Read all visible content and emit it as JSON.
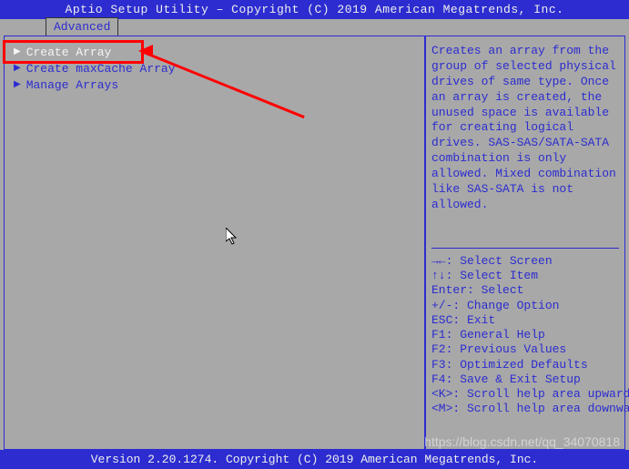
{
  "title": "Aptio Setup Utility – Copyright (C) 2019 American Megatrends, Inc.",
  "tab": {
    "label": "Advanced"
  },
  "menu": {
    "items": [
      {
        "label": "Create Array",
        "selected": true
      },
      {
        "label": "Create maxCache Array",
        "selected": false
      },
      {
        "label": "Manage Arrays",
        "selected": false
      }
    ]
  },
  "help": {
    "text": "Creates an array from the group of selected physical drives of same type. Once an array is created, the unused space is available for creating logical drives. SAS-SAS/SATA-SATA combination is only allowed. Mixed combination like SAS-SATA is not allowed."
  },
  "keys": {
    "k0": "→←: Select Screen",
    "k1": "↑↓: Select Item",
    "k2": "Enter: Select",
    "k3": "+/-: Change Option",
    "k4": "ESC: Exit",
    "k5": "F1: General Help",
    "k6": "F2: Previous Values",
    "k7": "F3: Optimized Defaults",
    "k8": "F4: Save & Exit Setup",
    "k9": "<K>: Scroll help area upwards",
    "k10": "<M>: Scroll help area downwards"
  },
  "footer": "Version 2.20.1274. Copyright (C) 2019 American Megatrends, Inc.",
  "watermark": "https://blog.csdn.net/qq_34070818"
}
